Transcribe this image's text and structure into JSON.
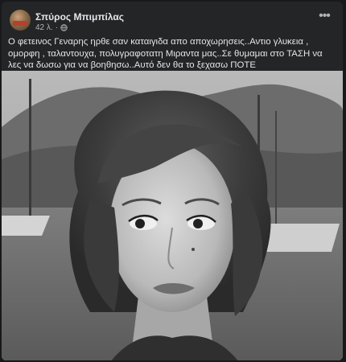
{
  "post": {
    "author": "Σπύρος Μπιμπίλας",
    "time": "42 λ.",
    "more_icon": "more-options-icon",
    "privacy_icon": "globe-icon",
    "text": "Ο φετεινος Γεναρης ηρθε σαν καταιγιδα απο αποχωρησεις..Αντιο γλυκεια , ομορφη , ταλαντουχα, πολυγραφοτατη Μιραντα μας..Σε θυμαμαι στο ΤΑΣΗ να λες να δωσω για να βοηθησω..Αυτό δεν θα το ξεχασω ΠΟΤΕ",
    "photo_icon": "post-photo"
  },
  "colors": {
    "background": "#18191a",
    "card": "#242526",
    "text": "#e4e6eb",
    "secondary_text": "#b0b3b8"
  }
}
